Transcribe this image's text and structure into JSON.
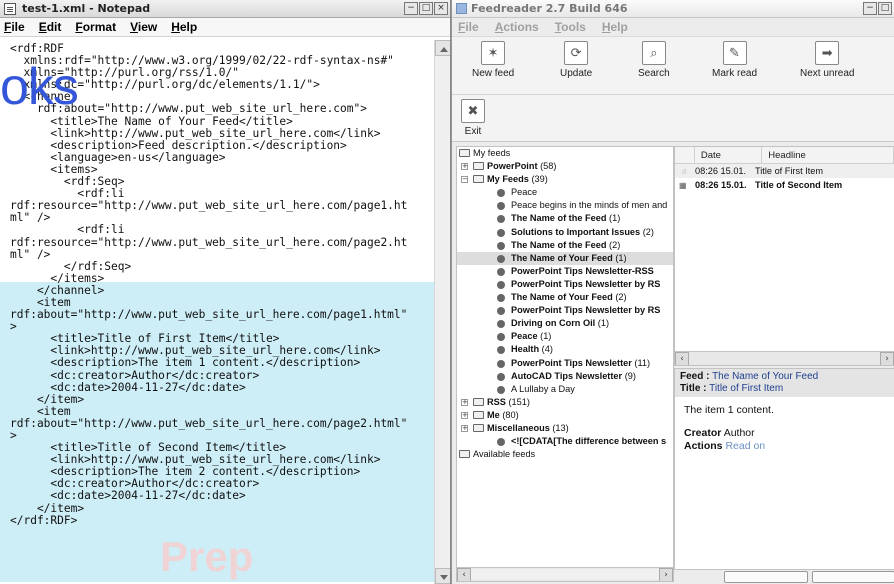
{
  "notepad": {
    "title": "test-1.xml - Notepad",
    "menu": [
      "File",
      "Edit",
      "Format",
      "View",
      "Help"
    ],
    "window_buttons": [
      "−",
      "□",
      "×"
    ],
    "content": "<rdf:RDF\n  xmlns:rdf=\"http://www.w3.org/1999/02/22-rdf-syntax-ns#\"\n  xmlns=\"http://purl.org/rss/1.0/\"\n  xmlns:dc=\"http://purl.org/dc/elements/1.1/\">\n  <channel\n    rdf:about=\"http://www.put_web_site_url_here.com\">\n      <title>The Name of Your Feed</title>\n      <link>http://www.put_web_site_url_here.com</link>\n      <description>Feed description.</description>\n      <language>en-us</language>\n      <items>\n        <rdf:Seq>\n          <rdf:li\nrdf:resource=\"http://www.put_web_site_url_here.com/page1.ht\nml\" />\n          <rdf:li\nrdf:resource=\"http://www.put_web_site_url_here.com/page2.ht\nml\" />\n        </rdf:Seq>\n      </items>\n    </channel>\n    <item\nrdf:about=\"http://www.put_web_site_url_here.com/page1.html\"\n>\n      <title>Title of First Item</title>\n      <link>http://www.put_web_site_url_here.com</link>\n      <description>The item 1 content.</description>\n      <dc:creator>Author</dc:creator>\n      <dc:date>2004-11-27</dc:date>\n    </item>\n    <item\nrdf:about=\"http://www.put_web_site_url_here.com/page2.html\"\n>\n      <title>Title of Second Item</title>\n      <link>http://www.put_web_site_url_here.com</link>\n      <description>The item 2 content.</description>\n      <dc:creator>Author</dc:creator>\n      <dc:date>2004-11-27</dc:date>\n    </item>\n</rdf:RDF>",
    "watermark": "oks"
  },
  "feedreader": {
    "title": "Feedreader 2.7 Build 646",
    "menu": [
      "File",
      "Actions",
      "Tools",
      "Help"
    ],
    "toolbar": [
      {
        "label": "New feed",
        "icon": "new-feed-icon"
      },
      {
        "label": "Update",
        "icon": "update-icon"
      },
      {
        "label": "Search",
        "icon": "search-icon"
      },
      {
        "label": "Mark read",
        "icon": "mark-read-icon"
      },
      {
        "label": "Next unread",
        "icon": "next-unread-icon"
      }
    ],
    "toolbar2": [
      {
        "label": "Exit",
        "icon": "exit-icon"
      }
    ],
    "tree": [
      {
        "label": "My feeds",
        "count": "",
        "bold": false,
        "type": "root"
      },
      {
        "label": "PowerPoint",
        "count": "(58)",
        "bold": true,
        "type": "folder"
      },
      {
        "label": "My Feeds",
        "count": "(39)",
        "bold": true,
        "type": "folder-open"
      },
      {
        "label": "Peace",
        "count": "",
        "bold": false,
        "type": "feed"
      },
      {
        "label": "Peace begins in the minds of men and",
        "count": "",
        "bold": false,
        "type": "feed"
      },
      {
        "label": "The Name of the Feed",
        "count": "(1)",
        "bold": true,
        "type": "feed"
      },
      {
        "label": "Solutions to Important Issues",
        "count": "(2)",
        "bold": true,
        "type": "feed"
      },
      {
        "label": "The Name of the Feed",
        "count": "(2)",
        "bold": true,
        "type": "feed"
      },
      {
        "label": "The Name of Your Feed",
        "count": "(1)",
        "bold": true,
        "type": "feed",
        "selected": true
      },
      {
        "label": "PowerPoint Tips Newsletter-RSS",
        "count": "",
        "bold": true,
        "type": "feed"
      },
      {
        "label": "PowerPoint Tips Newsletter by RS",
        "count": "",
        "bold": true,
        "type": "feed"
      },
      {
        "label": "The Name of Your Feed",
        "count": "(2)",
        "bold": true,
        "type": "feed"
      },
      {
        "label": "PowerPoint Tips Newsletter by RS",
        "count": "",
        "bold": true,
        "type": "feed"
      },
      {
        "label": "Driving on Corn Oil",
        "count": "(1)",
        "bold": true,
        "type": "feed"
      },
      {
        "label": "Peace",
        "count": "(1)",
        "bold": true,
        "type": "feed"
      },
      {
        "label": "Health",
        "count": "(4)",
        "bold": true,
        "type": "feed"
      },
      {
        "label": "PowerPoint Tips Newsletter",
        "count": "(11)",
        "bold": true,
        "type": "feed"
      },
      {
        "label": "AutoCAD Tips Newsletter",
        "count": "(9)",
        "bold": true,
        "type": "feed"
      },
      {
        "label": "A Lullaby a Day",
        "count": "",
        "bold": false,
        "type": "feed"
      },
      {
        "label": "RSS",
        "count": "(151)",
        "bold": true,
        "type": "folder"
      },
      {
        "label": "Me",
        "count": "(80)",
        "bold": true,
        "type": "folder"
      },
      {
        "label": "Miscellaneous",
        "count": "(13)",
        "bold": true,
        "type": "folder"
      },
      {
        "label": "<![CDATA[The difference between s",
        "count": "",
        "bold": true,
        "type": "feed"
      },
      {
        "label": "Available feeds",
        "count": "",
        "bold": false,
        "type": "root2"
      }
    ],
    "headlines": {
      "columns": [
        "Date",
        "Headline"
      ],
      "rows": [
        {
          "date": "08:26 15.01.",
          "headline": "Title of First Item",
          "bold": false
        },
        {
          "date": "08:26 15.01.",
          "headline": "Title of Second Item",
          "bold": true
        }
      ]
    },
    "preview": {
      "feed_label": "Feed :",
      "feed_value": "The Name of Your Feed",
      "title_label": "Title :",
      "title_value": "Title of First Item",
      "content": "The item 1 content.",
      "creator_label": "Creator",
      "creator_value": "Author",
      "actions_label": "Actions",
      "actions_value": "Read on"
    },
    "watermark": "Prep"
  }
}
